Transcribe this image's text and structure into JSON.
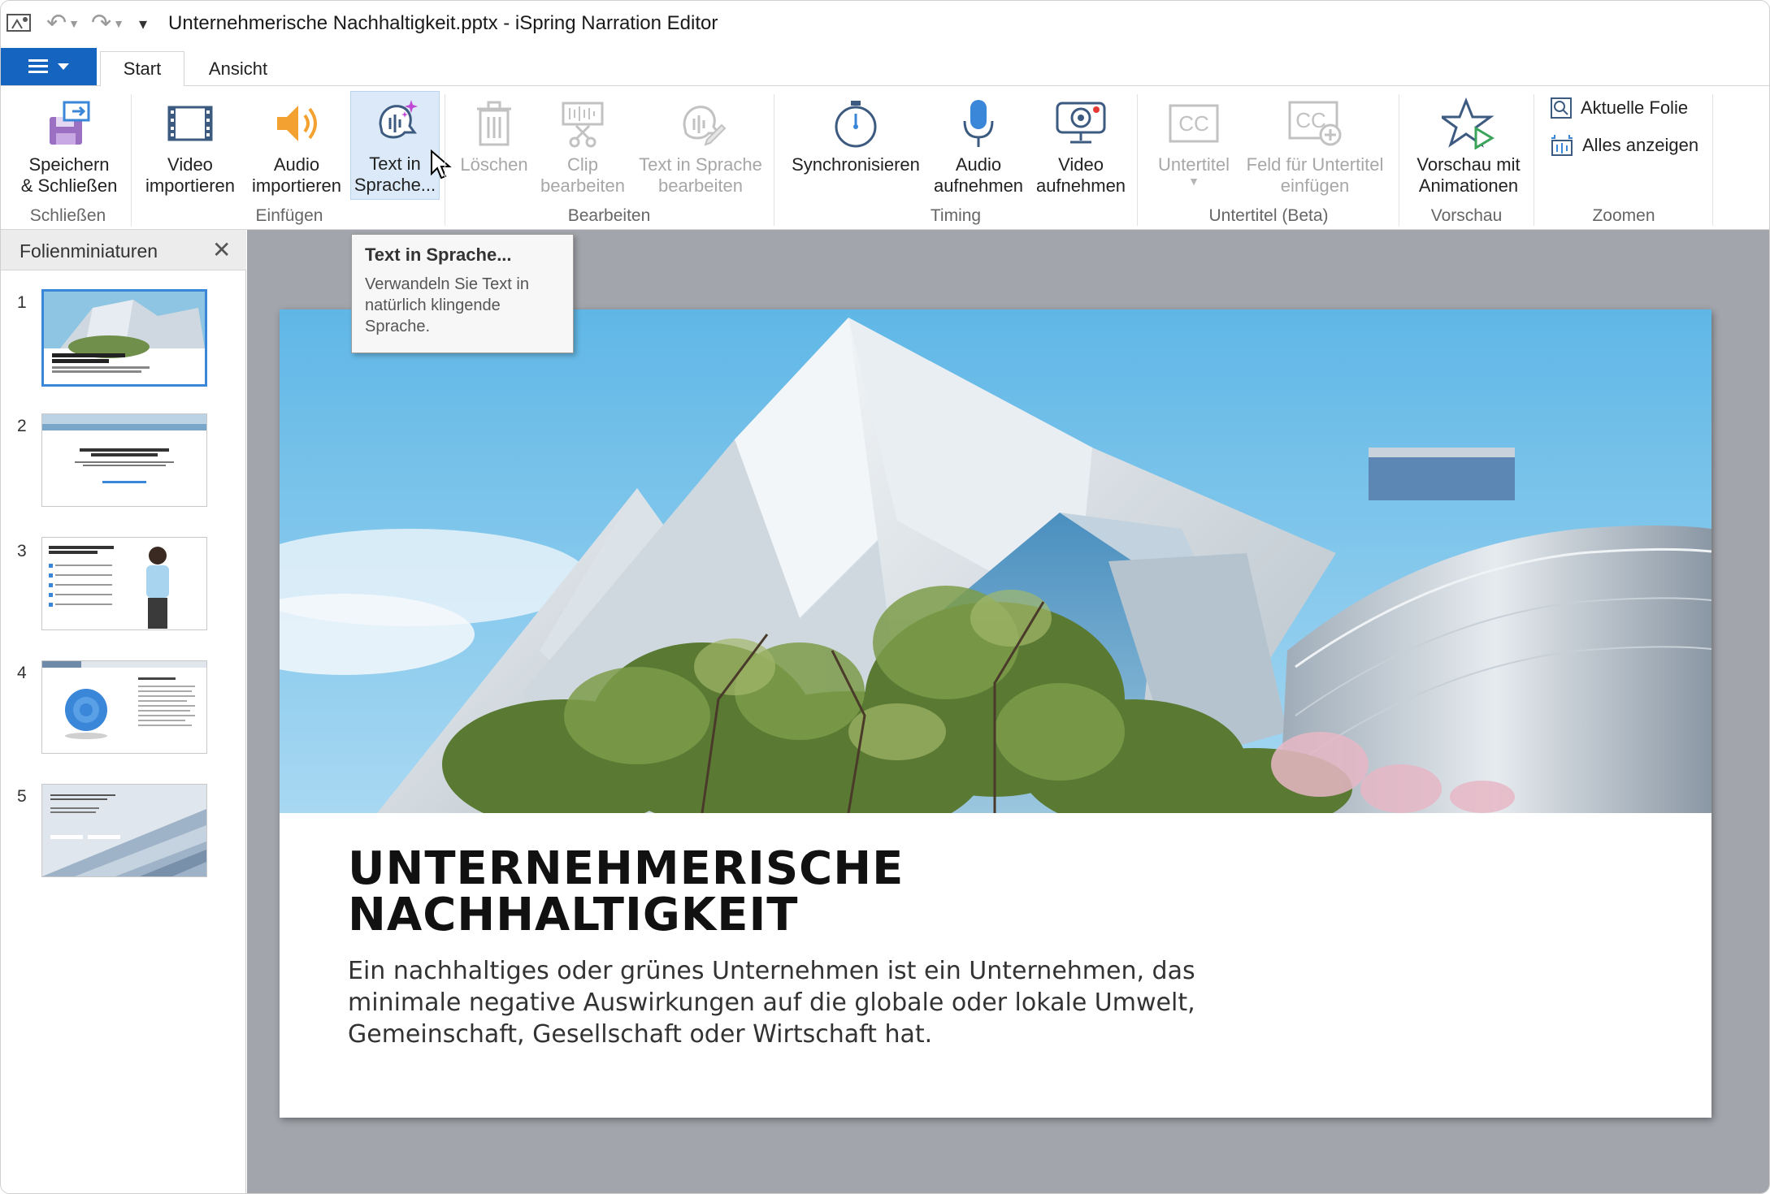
{
  "titlebar": {
    "title": "Unternehmerische Nachhaltigkeit.pptx - iSpring Narration Editor",
    "undo_icon": "undo-icon",
    "redo_icon": "redo-icon"
  },
  "tabs": [
    {
      "label": "Start",
      "active": true
    },
    {
      "label": "Ansicht",
      "active": false
    }
  ],
  "ribbon": {
    "groups": [
      {
        "label": "Schließen"
      },
      {
        "label": "Einfügen"
      },
      {
        "label": "Bearbeiten"
      },
      {
        "label": "Timing"
      },
      {
        "label": "Untertitel (Beta)"
      },
      {
        "label": "Vorschau"
      },
      {
        "label": "Zoomen"
      }
    ],
    "buttons": {
      "save_close": "Speichern\n& Schließen",
      "import_video": "Video\nimportieren",
      "import_audio": "Audio\nimportieren",
      "tts": "Text in\nSprache...",
      "delete": "Löschen",
      "edit_clip": "Clip\nbearbeiten",
      "edit_tts": "Text in Sprache\nbearbeiten",
      "sync": "Synchronisieren",
      "record_audio": "Audio\naufnehmen",
      "record_video": "Video\naufnehmen",
      "subtitles": "Untertitel",
      "subtitle_field": "Feld für Untertitel\neinfügen",
      "preview_anim": "Vorschau mit\nAnimationen",
      "current_slide": "Aktuelle Folie",
      "show_all": "Alles anzeigen"
    }
  },
  "tooltip": {
    "title": "Text in Sprache...",
    "body": "Verwandeln Sie Text in natürlich klingende Sprache."
  },
  "thumbnails": {
    "title": "Folienminiaturen",
    "items": [
      {
        "num": "1",
        "selected": true
      },
      {
        "num": "2",
        "selected": false
      },
      {
        "num": "3",
        "selected": false
      },
      {
        "num": "4",
        "selected": false
      },
      {
        "num": "5",
        "selected": false
      }
    ]
  },
  "slide": {
    "title_line1": "UNTERNEHMERISCHE",
    "title_line2": "NACHHALTIGKEIT",
    "body": "Ein nachhaltiges oder grünes Unternehmen ist ein Unternehmen, das minimale negative Auswirkungen auf die globale oder lokale Umwelt, Gemeinschaft, Gesellschaft oder Wirtschaft hat."
  },
  "colors": {
    "accent": "#1565c0",
    "selection": "#3a86d9",
    "hover": "#dbe9f8",
    "canvas_bg": "#a2a5ab"
  }
}
